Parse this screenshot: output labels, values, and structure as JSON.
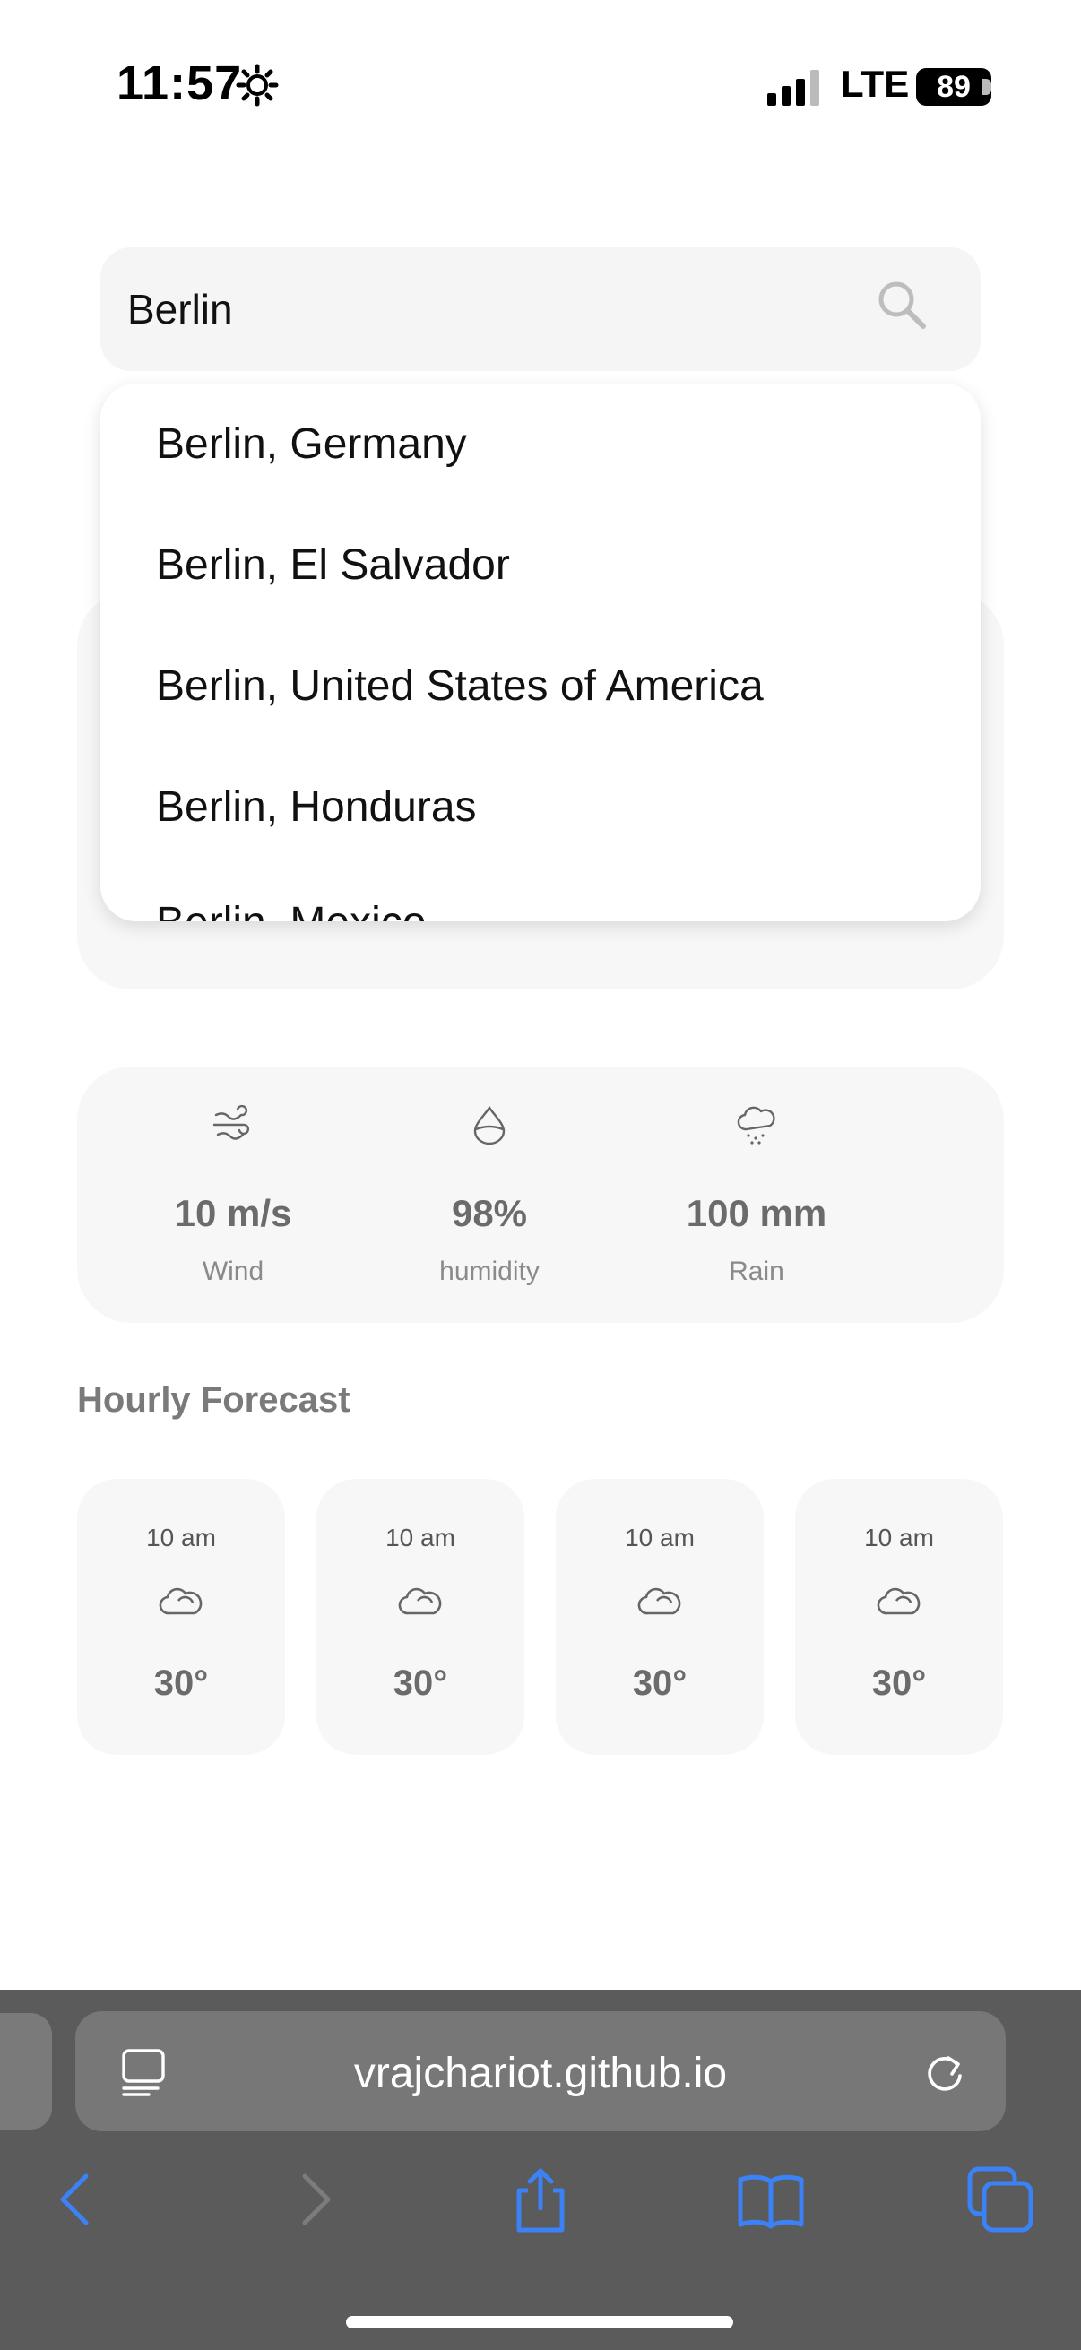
{
  "status_bar": {
    "time": "11:57",
    "network": "LTE",
    "battery": "89"
  },
  "search": {
    "value": "Berlin",
    "placeholder": ""
  },
  "suggestions": [
    "Berlin, Germany",
    "Berlin, El Salvador",
    "Berlin, United States of America",
    "Berlin, Honduras",
    "Berlin, Mexico"
  ],
  "stats": [
    {
      "value": "10 m/s",
      "label": "Wind",
      "icon": "wind-icon"
    },
    {
      "value": "98%",
      "label": "humidity",
      "icon": "humidity-drop-icon"
    },
    {
      "value": "100 mm",
      "label": "Rain",
      "icon": "rain-cloud-icon"
    }
  ],
  "hourly": {
    "title": "Hourly Forecast",
    "items": [
      {
        "time": "10 am",
        "temp": "30°",
        "icon": "cloud-icon"
      },
      {
        "time": "10 am",
        "temp": "30°",
        "icon": "cloud-icon"
      },
      {
        "time": "10 am",
        "temp": "30°",
        "icon": "cloud-icon"
      },
      {
        "time": "10 am",
        "temp": "30°",
        "icon": "cloud-icon"
      }
    ]
  },
  "browser": {
    "url": "vrajchariot.github.io"
  },
  "colors": {
    "accent": "#3b82f6",
    "card_bg": "#f7f7f7",
    "toolbar_bg": "#5b5b5b"
  }
}
